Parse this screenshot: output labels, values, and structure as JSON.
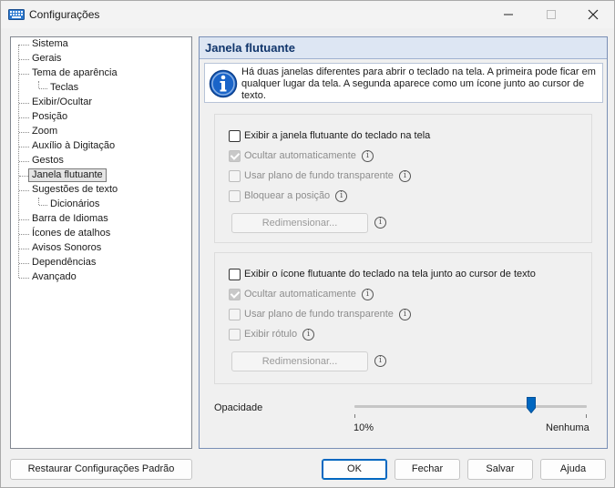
{
  "window": {
    "title": "Configurações"
  },
  "tree": {
    "items": [
      {
        "label": "Sistema"
      },
      {
        "label": "Gerais"
      },
      {
        "label": "Tema de aparência"
      },
      {
        "label": "Teclas"
      },
      {
        "label": "Exibir/Ocultar"
      },
      {
        "label": "Posição"
      },
      {
        "label": "Zoom"
      },
      {
        "label": "Auxílio à Digitação"
      },
      {
        "label": "Gestos"
      },
      {
        "label": "Janela flutuante",
        "selected": true
      },
      {
        "label": "Sugestões de texto"
      },
      {
        "label": "Dicionários"
      },
      {
        "label": "Barra de Idiomas"
      },
      {
        "label": "Ícones de atalhos"
      },
      {
        "label": "Avisos Sonoros"
      },
      {
        "label": "Dependências"
      },
      {
        "label": "Avançado"
      }
    ]
  },
  "panel": {
    "title": "Janela flutuante",
    "info_text": "Há duas janelas diferentes para abrir o teclado na tela. A primeira pode ficar em qualquer lugar da tela. A segunda aparece como um ícone junto ao cursor de texto.",
    "group1": {
      "main_checkbox": "Exibir a janela flutuante do teclado na tela",
      "auto_hide": "Ocultar automaticamente",
      "transparent_bg": "Usar plano de fundo transparente",
      "lock_position": "Bloquear a posição",
      "resize_button": "Redimensionar..."
    },
    "group2": {
      "main_checkbox": "Exibir o ícone flutuante do teclado na tela junto ao cursor de texto",
      "auto_hide": "Ocultar automaticamente",
      "transparent_bg": "Usar plano de fundo transparente",
      "show_label": "Exibir rótulo",
      "resize_button": "Redimensionar..."
    },
    "opacity": {
      "label": "Opacidade",
      "min_label": "10%",
      "max_label": "Nenhuma",
      "value_fraction": 0.76
    }
  },
  "buttons": {
    "restore": "Restaurar Configurações Padrão",
    "ok": "OK",
    "cancel": "Fechar",
    "save": "Salvar",
    "help": "Ajuda"
  },
  "colors": {
    "accent": "#0067c0",
    "header_bg": "#dde6f3",
    "header_text": "#10356b"
  }
}
